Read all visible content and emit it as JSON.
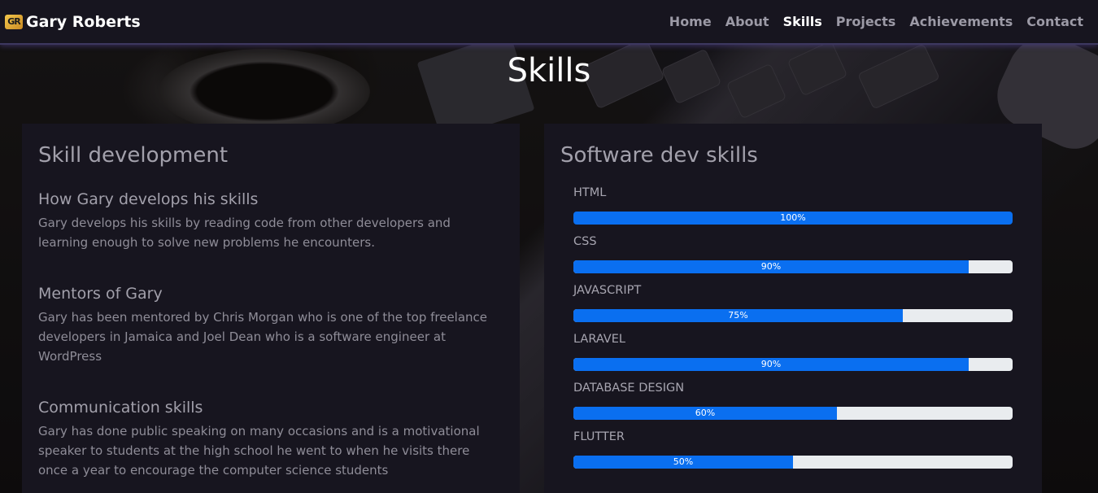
{
  "brand": {
    "logo_text": "GR",
    "name": "Gary Roberts"
  },
  "nav": {
    "items": [
      {
        "label": "Home",
        "active": false
      },
      {
        "label": "About",
        "active": false
      },
      {
        "label": "Skills",
        "active": true
      },
      {
        "label": "Projects",
        "active": false
      },
      {
        "label": "Achievements",
        "active": false
      },
      {
        "label": "Contact",
        "active": false
      }
    ]
  },
  "page": {
    "title": "Skills"
  },
  "left_card": {
    "heading": "Skill development",
    "topics": [
      {
        "title": "How Gary develops his skills",
        "text": "Gary develops his skills by reading code from other developers and learning enough to solve new problems he encounters."
      },
      {
        "title": "Mentors of Gary",
        "text": "Gary has been mentored by Chris Morgan who is one of the top freelance developers in Jamaica and Joel Dean who is a software engineer at WordPress"
      },
      {
        "title": "Communication skills",
        "text": "Gary has done public speaking on many occasions and is a motivational speaker to students at the high school he went to when he visits there once a year to encourage the computer science students"
      }
    ]
  },
  "right_card": {
    "heading": "Software dev skills",
    "skills": [
      {
        "name": "HTML",
        "percent": 100,
        "label": "100%"
      },
      {
        "name": "CSS",
        "percent": 90,
        "label": "90%"
      },
      {
        "name": "JAVASCRIPT",
        "percent": 75,
        "label": "75%"
      },
      {
        "name": "LARAVEL",
        "percent": 90,
        "label": "90%"
      },
      {
        "name": "DATABASE DESIGN",
        "percent": 60,
        "label": "60%"
      },
      {
        "name": "FLUTTER",
        "percent": 50,
        "label": "50%"
      }
    ]
  },
  "colors": {
    "bar_fill": "#0a6ff0",
    "bar_track": "#e9ecef",
    "card_bg": "#17151f",
    "nav_bg": "#17151f"
  }
}
